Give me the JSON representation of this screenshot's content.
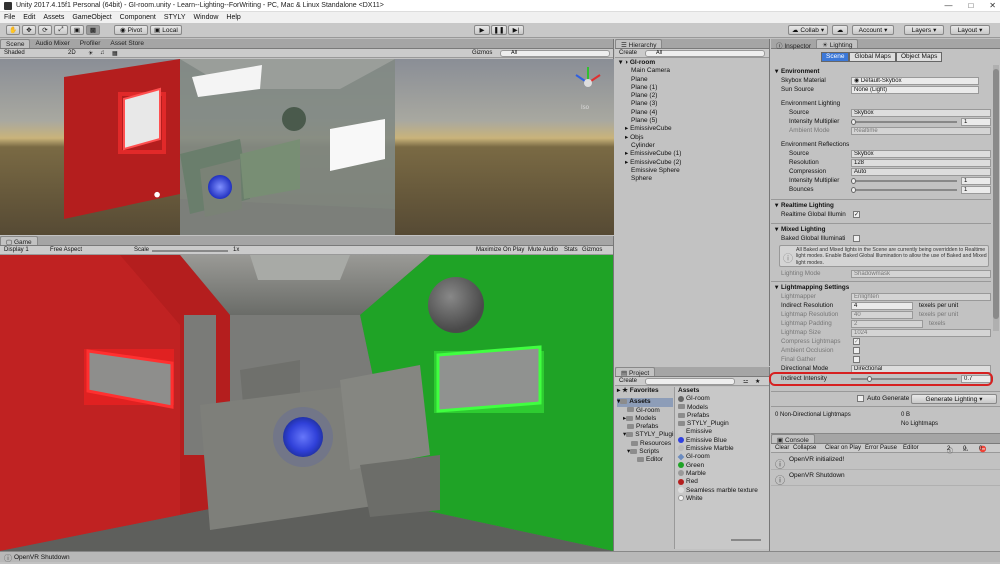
{
  "title_bar": {
    "text": "Unity 2017.4.15f1 Personal (64bit) - GI-room.unity - Learn--Lighting--ForWriting - PC, Mac & Linux Standalone <DX11>"
  },
  "menu": [
    "File",
    "Edit",
    "Assets",
    "GameObject",
    "Component",
    "STYLY",
    "Window",
    "Help"
  ],
  "toolbar": {
    "pivot": "Pivot",
    "local": "Local",
    "collab": "Collab",
    "account": "Account",
    "layers": "Layers",
    "layout": "Layout"
  },
  "scene_tabs": [
    "Scene",
    "Audio Mixer",
    "Profiler",
    "Asset Store"
  ],
  "scene_bar": {
    "shading": "Shaded",
    "mode2d": "2D",
    "gizmos": "Gizmos",
    "search": "All"
  },
  "gizmo_label": "Iso",
  "game_tab": "Game",
  "game_bar": {
    "display": "Display 1",
    "aspect": "Free Aspect",
    "scale_label": "Scale",
    "scale_value": "1x",
    "maximize": "Maximize On Play",
    "mute": "Mute Audio",
    "stats": "Stats",
    "gizmos": "Gizmos"
  },
  "hierarchy": {
    "tab": "Hierarchy",
    "create": "Create",
    "search": "All",
    "root": "GI-room",
    "items": [
      "Main Camera",
      "Plane",
      "Plane (1)",
      "Plane (2)",
      "Plane (3)",
      "Plane (4)",
      "Plane (5)",
      "EmissiveCube",
      "Objs",
      "Cylinder",
      "EmissiveCube (1)",
      "EmissiveCube (2)",
      "Emissive Sphere",
      "Sphere"
    ]
  },
  "project": {
    "tab": "Project",
    "create": "Create",
    "favorites": "Favorites",
    "assets_header": "Assets",
    "tree": [
      "Assets",
      "GI-room",
      "Models",
      "Prefabs",
      "STYLY_Plugin",
      "Resources",
      "Scripts",
      "Editor"
    ],
    "files": [
      "GI-room",
      "Models",
      "Prefabs",
      "STYLY_Plugin",
      "Emissive",
      "Emissive Blue",
      "Emissive Marble",
      "GI-room",
      "Green",
      "Marble",
      "Red",
      "Seamless marble texture",
      "White"
    ]
  },
  "inspector": {
    "tab1": "Inspector",
    "tab2": "Lighting",
    "sub_tabs": [
      "Scene",
      "Global Maps",
      "Object Maps"
    ],
    "environment": {
      "header": "Environment",
      "skybox_label": "Skybox Material",
      "skybox": "Default-Skybox",
      "sun_label": "Sun Source",
      "sun": "None (Light)",
      "env_lighting": "Environment Lighting",
      "source_label": "Source",
      "source": "Skybox",
      "intensity_label": "Intensity Multiplier",
      "intensity": "1",
      "ambient_label": "Ambient Mode",
      "ambient": "Realtime",
      "env_reflections": "Environment Reflections",
      "r_source": "Skybox",
      "resolution_label": "Resolution",
      "resolution": "128",
      "compression_label": "Compression",
      "compression": "Auto",
      "r_intensity": "1",
      "bounces_label": "Bounces",
      "bounces": "1"
    },
    "realtime": {
      "header": "Realtime Lighting",
      "gi_label": "Realtime Global Illumin"
    },
    "mixed": {
      "header": "Mixed Lighting",
      "baked_label": "Baked Global Illuminati",
      "info": "All Baked and Mixed lights in the Scene are currently being overridden to Realtime light modes. Enable Baked Global Illumination to allow the use of Baked and Mixed light modes.",
      "mode_label": "Lighting Mode",
      "mode": "Shadowmask"
    },
    "lightmapping": {
      "header": "Lightmapping Settings",
      "lightmapper_label": "Lightmapper",
      "lightmapper": "Enlighten",
      "indirect_res_label": "Indirect Resolution",
      "indirect_res": "4",
      "texels": "texels per unit",
      "lm_res_label": "Lightmap Resolution",
      "lm_res": "40",
      "padding_label": "Lightmap Padding",
      "padding": "2",
      "texels2": "texels",
      "size_label": "Lightmap Size",
      "size": "1024",
      "compress_label": "Compress Lightmaps",
      "ao_label": "Ambient Occlusion",
      "fg_label": "Final Gather",
      "dir_label": "Directional Mode",
      "dir": "Directional",
      "indirect_label": "Indirect Intensity",
      "indirect": "0.7"
    },
    "auto_generate": "Auto Generate",
    "generate": "Generate Lighting",
    "stats": {
      "left": "0 Non-Directional Lightmaps",
      "mid": "0 B",
      "right": "No Lightmaps"
    }
  },
  "console": {
    "tab": "Console",
    "buttons": [
      "Clear",
      "Collapse",
      "Clear on Play",
      "Error Pause",
      "Editor"
    ],
    "counts": [
      "2",
      "0",
      "0"
    ],
    "messages": [
      "OpenVR initialized!",
      "OpenVR Shutdown"
    ]
  },
  "status": "OpenVR Shutdown",
  "colors": {
    "highlight": "#d62020",
    "red_wall": "#b41e1e",
    "green_wall": "#1fa326",
    "blue_glow": "#3040e0"
  }
}
